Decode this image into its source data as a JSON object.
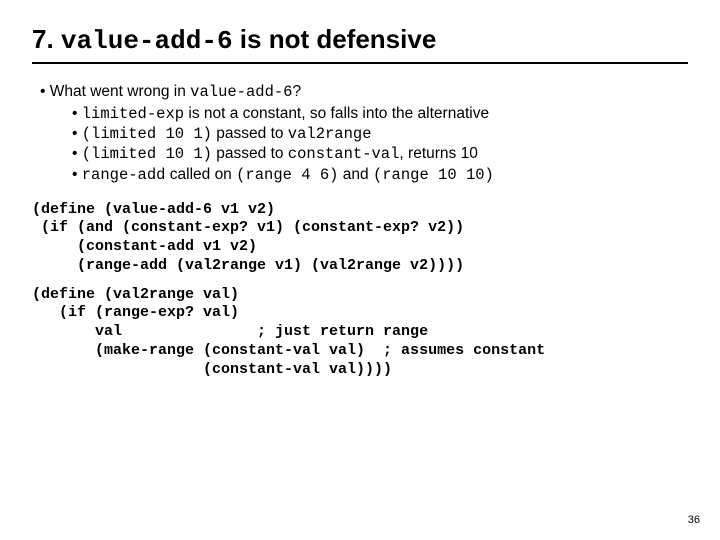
{
  "title": {
    "num": "7.",
    "code": "value-add-6",
    "rest": " is not defensive"
  },
  "lead": {
    "pre": "What went wrong in ",
    "code": "value-add-6",
    "post": "?"
  },
  "b1": {
    "code": "limited-exp",
    "rest": " is not a constant, so falls into the alternative"
  },
  "b2": {
    "code1": "(limited 10 1)",
    "mid": " passed to ",
    "code2": "val2range"
  },
  "b3": {
    "code1": "(limited 10 1)",
    "mid": " passed to ",
    "code2": "constant-val",
    "rest": ", returns 10"
  },
  "b4": {
    "code1": "range-add",
    "mid1": " called on ",
    "code2": "(range 4 6)",
    "mid2": " and ",
    "code3": "(range 10 10)"
  },
  "code1": "(define (value-add-6 v1 v2)\n (if (and (constant-exp? v1) (constant-exp? v2))\n     (constant-add v1 v2)\n     (range-add (val2range v1) (val2range v2))))",
  "code2": "(define (val2range val)\n   (if (range-exp? val)\n       val               ; just return range\n       (make-range (constant-val val)  ; assumes constant\n                   (constant-val val))))",
  "pagenum": "36"
}
